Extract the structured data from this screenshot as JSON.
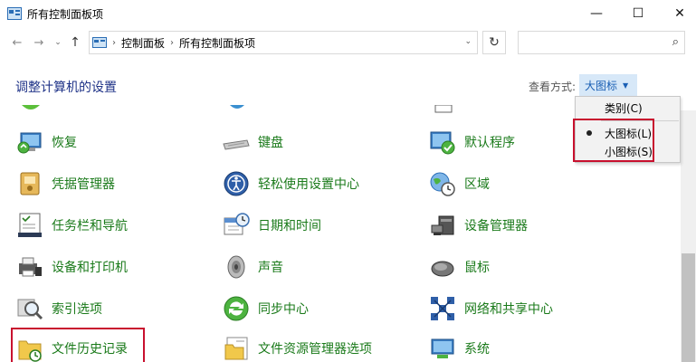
{
  "window": {
    "title": "所有控制面板项"
  },
  "controls": {
    "minimize": "—",
    "maximize": "☐",
    "close": "✕"
  },
  "nav": {
    "back": "←",
    "forward": "→",
    "recent": "⌄",
    "up": "↑",
    "breadcrumbs": [
      "控制面板",
      "所有控制面板项"
    ],
    "refresh": "↻",
    "search_icon": "⌕"
  },
  "header": {
    "title": "调整计算机的设置",
    "view_by_label": "查看方式:",
    "view_by_value": "大图标"
  },
  "view_menu": {
    "items": [
      "类别(C)",
      "大图标(L)",
      "小图标(S)"
    ],
    "selected": "大图标(L)"
  },
  "items": {
    "col1": [
      "恢复",
      "凭据管理器",
      "任务栏和导航",
      "设备和打印机",
      "索引选项",
      "文件历史记录"
    ],
    "col2": [
      "键盘",
      "轻松使用设置中心",
      "日期和时间",
      "声音",
      "同步中心",
      "文件资源管理器选项"
    ],
    "col3": [
      "默认程序",
      "区域",
      "设备管理器",
      "鼠标",
      "网络和共享中心",
      "系统"
    ]
  },
  "colors": {
    "link_green": "#1a7a1a",
    "heading_blue": "#1e3287",
    "highlight_red": "#c8102e",
    "view_bg": "#d7e8f8"
  }
}
